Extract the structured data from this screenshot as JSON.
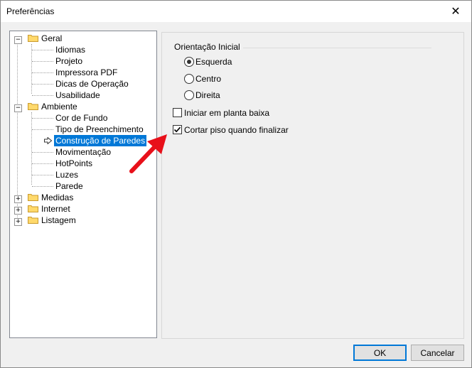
{
  "window": {
    "title": "Preferências",
    "close_glyph": "✕"
  },
  "tree": {
    "groups": [
      {
        "label": "Geral",
        "children": [
          "Idiomas",
          "Projeto",
          "Impressora PDF",
          "Dicas de Operação",
          "Usabilidade"
        ]
      },
      {
        "label": "Ambiente",
        "children": [
          "Cor de Fundo",
          "Tipo de Preenchimento",
          "Construção de Paredes",
          "Movimentação",
          "HotPoints",
          "Luzes",
          "Parede"
        ]
      },
      {
        "label": "Medidas"
      },
      {
        "label": "Internet"
      },
      {
        "label": "Listagem"
      }
    ],
    "selected": "Construção de Paredes",
    "expander_open": "−",
    "expander_closed": "+"
  },
  "panel": {
    "group_title": "Orientação Inicial",
    "radios": [
      {
        "label": "Esquerda",
        "checked": true
      },
      {
        "label": "Centro",
        "checked": false
      },
      {
        "label": "Direita",
        "checked": false
      }
    ],
    "checkboxes": [
      {
        "label": "Iniciar em planta baixa",
        "checked": false
      },
      {
        "label": "Cortar piso quando finalizar",
        "checked": true
      }
    ]
  },
  "buttons": {
    "ok": "OK",
    "cancel": "Cancelar"
  },
  "colors": {
    "selection": "#0078d7",
    "annotation_arrow": "#e8101a"
  }
}
